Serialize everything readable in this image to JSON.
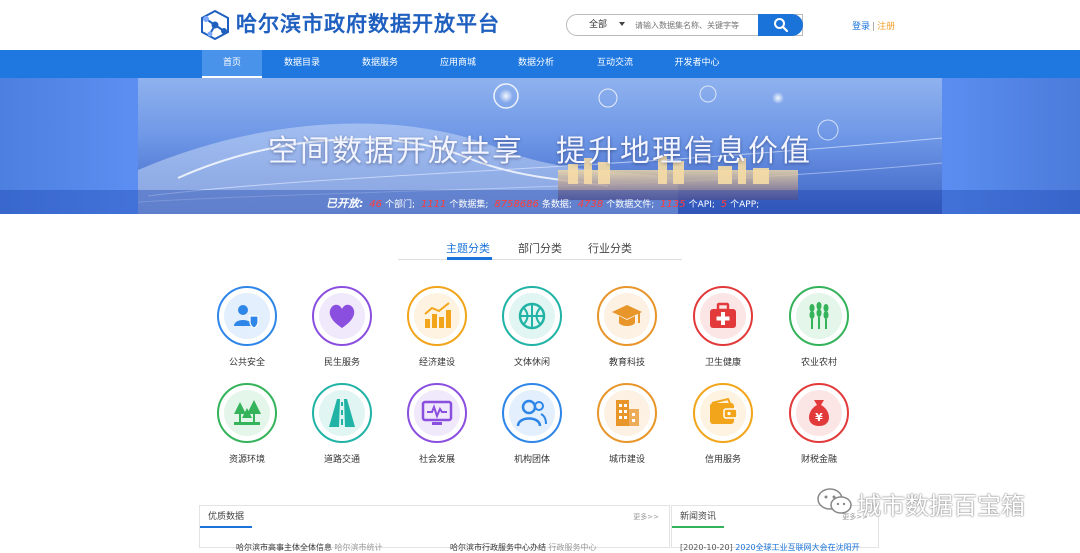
{
  "header": {
    "title": "哈尔滨市政府数据开放平台",
    "search_category": "全部",
    "search_placeholder": "请输入数据集名称、关键字等",
    "login": "登录",
    "separator": "|",
    "register": "注册"
  },
  "nav": [
    "首页",
    "数据目录",
    "数据服务",
    "应用商城",
    "数据分析",
    "互动交流",
    "开发者中心"
  ],
  "banner": {
    "title": "空间数据开放共享　提升地理信息价值",
    "stats_label": "已开放:",
    "stats": [
      {
        "value": "46",
        "unit": "个部门;"
      },
      {
        "value": "1111",
        "unit": "个数据集;"
      },
      {
        "value": "8758686",
        "unit": "条数据;"
      },
      {
        "value": "4738",
        "unit": "个数据文件;"
      },
      {
        "value": "1135",
        "unit": "个API;"
      },
      {
        "value": "5",
        "unit": "个APP;"
      }
    ]
  },
  "tabs": [
    "主题分类",
    "部门分类",
    "行业分类"
  ],
  "categories": [
    {
      "label": "公共安全",
      "color": "#2e86e8",
      "icon": "shield-person-icon"
    },
    {
      "label": "民生服务",
      "color": "#8b4fe0",
      "icon": "heart-icon"
    },
    {
      "label": "经济建设",
      "color": "#f2a51a",
      "icon": "bar-chart-icon"
    },
    {
      "label": "文体休闲",
      "color": "#20b3a6",
      "icon": "basketball-icon"
    },
    {
      "label": "教育科技",
      "color": "#e8952a",
      "icon": "graduation-cap-icon"
    },
    {
      "label": "卫生健康",
      "color": "#e23a3a",
      "icon": "medical-kit-icon"
    },
    {
      "label": "农业农村",
      "color": "#34b35a",
      "icon": "wheat-icon"
    },
    {
      "label": "资源环境",
      "color": "#34b35a",
      "icon": "trees-icon"
    },
    {
      "label": "道路交通",
      "color": "#20b3a6",
      "icon": "road-icon"
    },
    {
      "label": "社会发展",
      "color": "#8b4fe0",
      "icon": "monitor-icon"
    },
    {
      "label": "机构团体",
      "color": "#2e86e8",
      "icon": "people-icon"
    },
    {
      "label": "城市建设",
      "color": "#e8952a",
      "icon": "buildings-icon"
    },
    {
      "label": "信用服务",
      "color": "#f2a51a",
      "icon": "wallet-icon"
    },
    {
      "label": "财税金融",
      "color": "#e23a3a",
      "icon": "money-bag-icon"
    }
  ],
  "panels": {
    "quality": {
      "title": "优质数据",
      "more": "更多>>",
      "item1": "哈尔滨市高事主体全体信息",
      "item1_tag": "哈尔滨市统计",
      "item2": "哈尔滨市行政服务中心办结",
      "item2_tag": "行政服务中心"
    },
    "news": {
      "title": "新闻资讯",
      "more": "更多>>",
      "date": "[2020-10-20]",
      "headline": "2020全球工业互联网大会在沈阳开"
    }
  },
  "watermark": "城市数据百宝箱"
}
